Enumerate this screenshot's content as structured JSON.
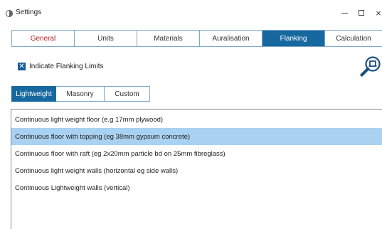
{
  "window": {
    "title": "Settings",
    "minimize_label": "–",
    "maximize_label": "□",
    "close_label": "×"
  },
  "main_tabs": [
    {
      "label": "General",
      "active": false
    },
    {
      "label": "Units",
      "active": false
    },
    {
      "label": "Materials",
      "active": false
    },
    {
      "label": "Auralisation",
      "active": false
    },
    {
      "label": "Flanking",
      "active": true
    },
    {
      "label": "Calculation",
      "active": false
    }
  ],
  "flanking_limits": {
    "label": "Indicate Flanking Limits",
    "checked": true,
    "check_glyph": "✕"
  },
  "search_button_icon": "zoom-search-icon",
  "sub_tabs": [
    {
      "label": "Lightweight",
      "active": true
    },
    {
      "label": "Masonry",
      "active": false
    },
    {
      "label": "Custom",
      "active": false
    }
  ],
  "list_items": [
    {
      "label": "Continuous light weight floor (e.g 17mm plywood)",
      "selected": false
    },
    {
      "label": "Continuous floor with topping (eg 38mm gypsum concrete)",
      "selected": true
    },
    {
      "label": "Continuous floor with raft (eg 2x20mm particle bd on 25mm fibreglass)",
      "selected": false
    },
    {
      "label": "Continuous light weight walls (horizontal eg side walls)",
      "selected": false
    },
    {
      "label": "Continuous Lightweight walls (vertical)",
      "selected": false
    }
  ],
  "colors": {
    "accent": "#17689f",
    "tab_border": "#7fa7c9",
    "first_tab_text": "#b02020",
    "selection": "#a9d1f1",
    "checkbox": "#1a5d99"
  }
}
